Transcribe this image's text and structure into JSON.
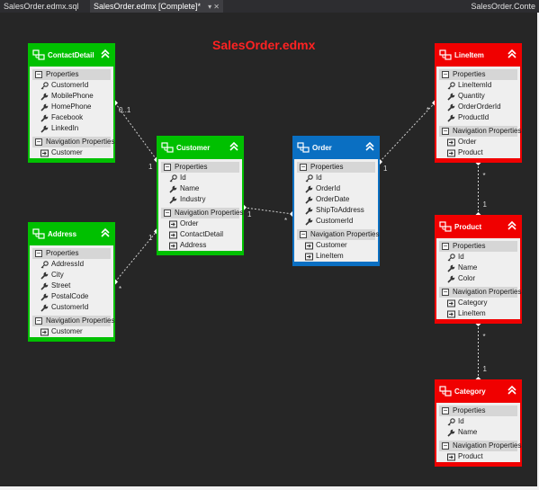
{
  "tabs": [
    {
      "label": "SalesOrder.edmx.sql"
    },
    {
      "label": "SalesOrder.edmx [Complete]*",
      "icons": "▾ ✕"
    },
    {
      "label": "SalesOrder.Conte"
    }
  ],
  "title": "SalesOrder.edmx",
  "colors": {
    "green": "#00c000",
    "blue": "#0a6fc2",
    "red": "#f00000",
    "canvas": "#262626"
  },
  "section_labels": {
    "properties": "Properties",
    "navigation": "Navigation Properties"
  },
  "icons": {
    "entity": "entity-icon",
    "key": "key-icon",
    "property": "wrench-icon",
    "navigation": "navigation-property-icon",
    "collapse": "collapse-chevron-icon",
    "expand_minus": "minus-icon"
  },
  "entities": [
    {
      "name": "ContactDetail",
      "color": "green",
      "key": [
        "CustomerId"
      ],
      "properties": [
        "MobilePhone",
        "HomePhone",
        "Facebook",
        "LinkedIn"
      ],
      "navigation": [
        "Customer"
      ]
    },
    {
      "name": "Address",
      "color": "green",
      "key": [
        "AddressId"
      ],
      "properties": [
        "City",
        "Street",
        "PostalCode",
        "CustomerId"
      ],
      "navigation": [
        "Customer"
      ]
    },
    {
      "name": "Customer",
      "color": "green",
      "key": [
        "Id"
      ],
      "properties": [
        "Name",
        "Industry"
      ],
      "navigation": [
        "Order",
        "ContactDetail",
        "Address"
      ]
    },
    {
      "name": "Order",
      "color": "blue",
      "key": [
        "Id"
      ],
      "properties": [
        "OrderId",
        "OrderDate",
        "ShipToAddress",
        "CustomerId"
      ],
      "navigation": [
        "Customer",
        "LineItem"
      ]
    },
    {
      "name": "LineItem",
      "color": "red",
      "key": [
        "LineItemId"
      ],
      "properties": [
        "Quantity",
        "OrderOrderId",
        "ProductId"
      ],
      "navigation": [
        "Order",
        "Product"
      ]
    },
    {
      "name": "Product",
      "color": "red",
      "key": [
        "Id"
      ],
      "properties": [
        "Name",
        "Color"
      ],
      "navigation": [
        "Category",
        "LineItem"
      ]
    },
    {
      "name": "Category",
      "color": "red",
      "key": [
        "Id"
      ],
      "properties": [
        "Name"
      ],
      "navigation": [
        "Product"
      ]
    }
  ],
  "associations": [
    {
      "from": "ContactDetail",
      "to": "Customer",
      "from_mult": "0..1",
      "to_mult": "1"
    },
    {
      "from": "Address",
      "to": "Customer",
      "from_mult": "*",
      "to_mult": "1"
    },
    {
      "from": "Customer",
      "to": "Order",
      "from_mult": "1",
      "to_mult": "*"
    },
    {
      "from": "Order",
      "to": "LineItem",
      "from_mult": "1",
      "to_mult": "*"
    },
    {
      "from": "LineItem",
      "to": "Product",
      "from_mult": "*",
      "to_mult": "1"
    },
    {
      "from": "Product",
      "to": "Category",
      "from_mult": "*",
      "to_mult": "1"
    }
  ]
}
